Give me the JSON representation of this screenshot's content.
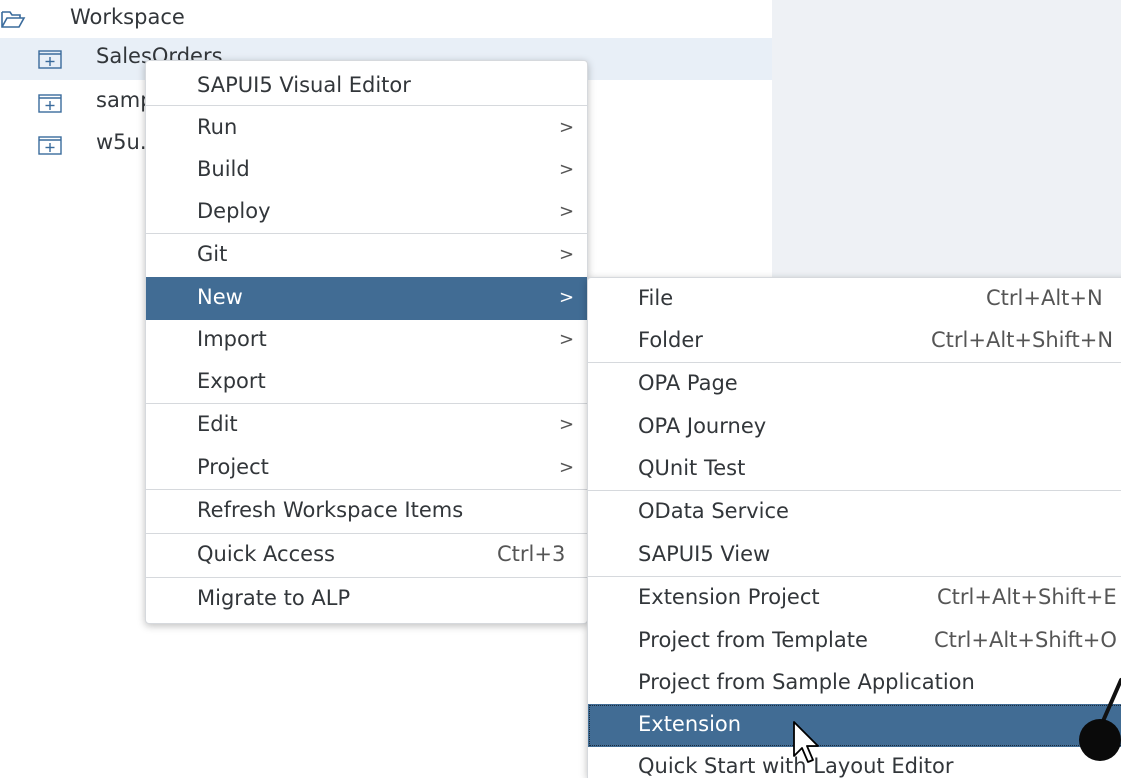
{
  "tree": {
    "root_label": "Workspace",
    "items": [
      {
        "label": "SalesOrders"
      },
      {
        "label": "samp"
      },
      {
        "label": "w5u."
      }
    ]
  },
  "context_menu": {
    "items": [
      {
        "label": "SAPUI5 Visual Editor",
        "arrow": "",
        "shortcut": ""
      },
      {
        "label": "Run",
        "arrow": ">",
        "shortcut": ""
      },
      {
        "label": "Build",
        "arrow": ">",
        "shortcut": ""
      },
      {
        "label": "Deploy",
        "arrow": ">",
        "shortcut": ""
      },
      {
        "label": "Git",
        "arrow": ">",
        "shortcut": ""
      },
      {
        "label": "New",
        "arrow": ">",
        "shortcut": ""
      },
      {
        "label": "Import",
        "arrow": ">",
        "shortcut": ""
      },
      {
        "label": "Export",
        "arrow": "",
        "shortcut": ""
      },
      {
        "label": "Edit",
        "arrow": ">",
        "shortcut": ""
      },
      {
        "label": "Project",
        "arrow": ">",
        "shortcut": ""
      },
      {
        "label": "Refresh Workspace Items",
        "arrow": "",
        "shortcut": ""
      },
      {
        "label": "Quick Access",
        "arrow": "",
        "shortcut": "Ctrl+3"
      },
      {
        "label": "Migrate to ALP",
        "arrow": "",
        "shortcut": ""
      }
    ]
  },
  "submenu": {
    "items": [
      {
        "label": "File",
        "shortcut": "Ctrl+Alt+N"
      },
      {
        "label": "Folder",
        "shortcut": "Ctrl+Alt+Shift+N"
      },
      {
        "label": "OPA Page",
        "shortcut": ""
      },
      {
        "label": "OPA Journey",
        "shortcut": ""
      },
      {
        "label": "QUnit Test",
        "shortcut": ""
      },
      {
        "label": "OData Service",
        "shortcut": ""
      },
      {
        "label": "SAPUI5 View",
        "shortcut": ""
      },
      {
        "label": "Extension Project",
        "shortcut": "Ctrl+Alt+Shift+E"
      },
      {
        "label": "Project from Template",
        "shortcut": "Ctrl+Alt+Shift+O"
      },
      {
        "label": "Project from Sample Application",
        "shortcut": ""
      },
      {
        "label": "Extension",
        "shortcut": ""
      },
      {
        "label": "Quick Start with Layout Editor",
        "shortcut": ""
      }
    ]
  },
  "colors": {
    "highlight": "#416c94",
    "selected_row": "#e8eff7",
    "right_panel": "#eef1f5"
  }
}
